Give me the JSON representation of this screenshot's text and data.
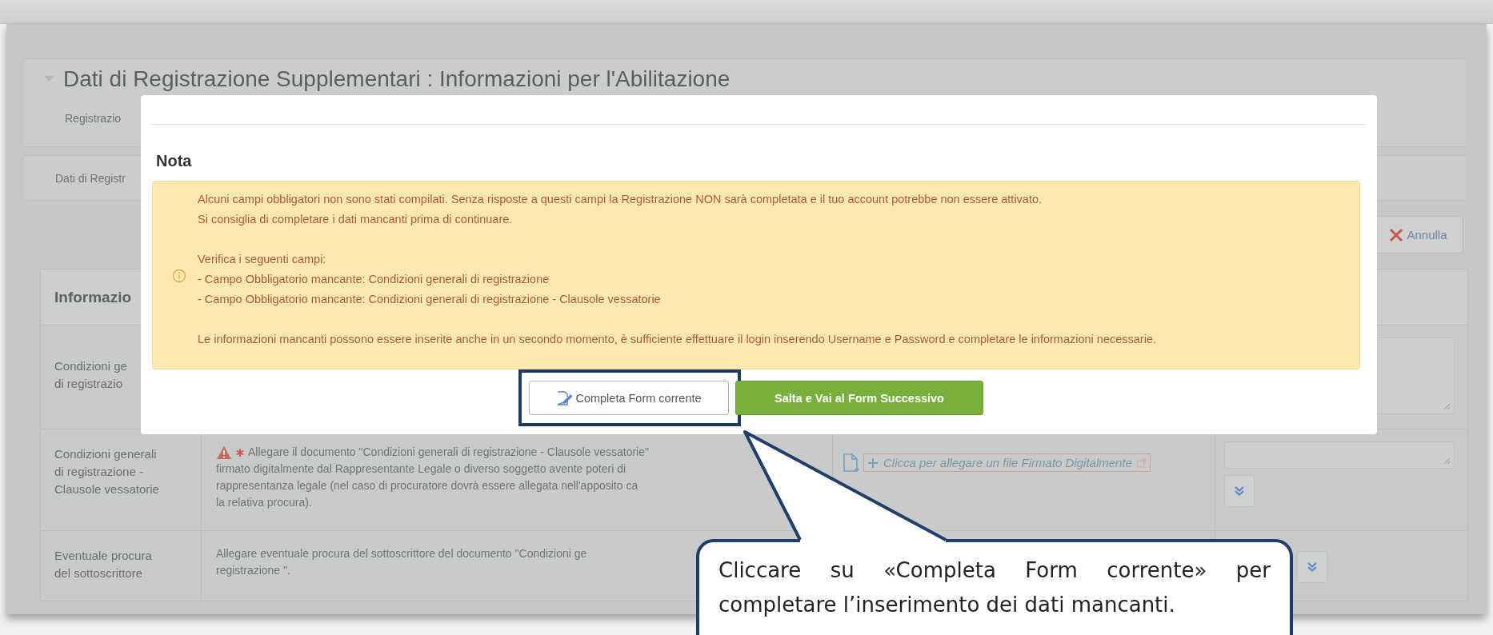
{
  "page": {
    "title": "Dati di Registrazione Supplementari : Informazioni per l'Abilitazione",
    "subtitle": "Registrazio",
    "breadcrumb": "Dati di Registr",
    "cancel_button": "Annulla"
  },
  "section": {
    "title": "Informazio",
    "rows": [
      {
        "kind": "notes",
        "label": [
          "Condizioni ge",
          "di registrazio"
        ]
      },
      {
        "kind": "attachment",
        "required": true,
        "label": [
          "Condizioni generali",
          "di registrazione -",
          "Clausole vessatorie"
        ],
        "description": [
          "Allegare il documento \"Condizioni generali di registrazione - Clausole vessatorie\"",
          "firmato digitalmente dal Rappresentante Legale o diverso soggetto avente poteri di",
          "rappresentanza legale (nel caso di procuratore dovrà essere allegata nell'apposito ca",
          "la relativa procura)."
        ],
        "attach_link": "Clicca per allegare un file Firmato Digitalmente"
      },
      {
        "kind": "expand",
        "required": false,
        "label": [
          "Eventuale procura",
          "del sottoscrittore"
        ],
        "description": [
          "Allegare eventuale procura del sottoscrittore del documento \"Condizioni ge",
          "registrazione \"."
        ]
      }
    ]
  },
  "modal": {
    "title": "Nota",
    "paragraphs": [
      [
        "Alcuni campi obbligatori non sono stati compilati. Senza risposte a questi campi la Registrazione NON sarà completata e il tuo account potrebbe non essere attivato.",
        "Si consiglia di completare i dati mancanti prima di continuare."
      ],
      [
        "Verifica i seguenti campi:",
        "- Campo Obbligatorio mancante: Condizioni generali di registrazione",
        "- Campo Obbligatorio mancante: Condizioni generali di registrazione - Clausole vessatorie"
      ],
      [
        "Le informazioni mancanti possono essere inserite anche in un secondo momento, è sufficiente effettuare il login inserendo Username e Password e completare le informazioni necessarie."
      ]
    ],
    "buttons": [
      {
        "kind": "default",
        "label": "Completa Form corrente",
        "highlighted": true
      },
      {
        "kind": "primary",
        "label": "Salta e Vai al Form Successivo",
        "highlighted": false
      }
    ]
  },
  "callout": {
    "text": "Cliccare su «Completa Form corrente» per completare l’inserimento dei dati mancanti."
  }
}
